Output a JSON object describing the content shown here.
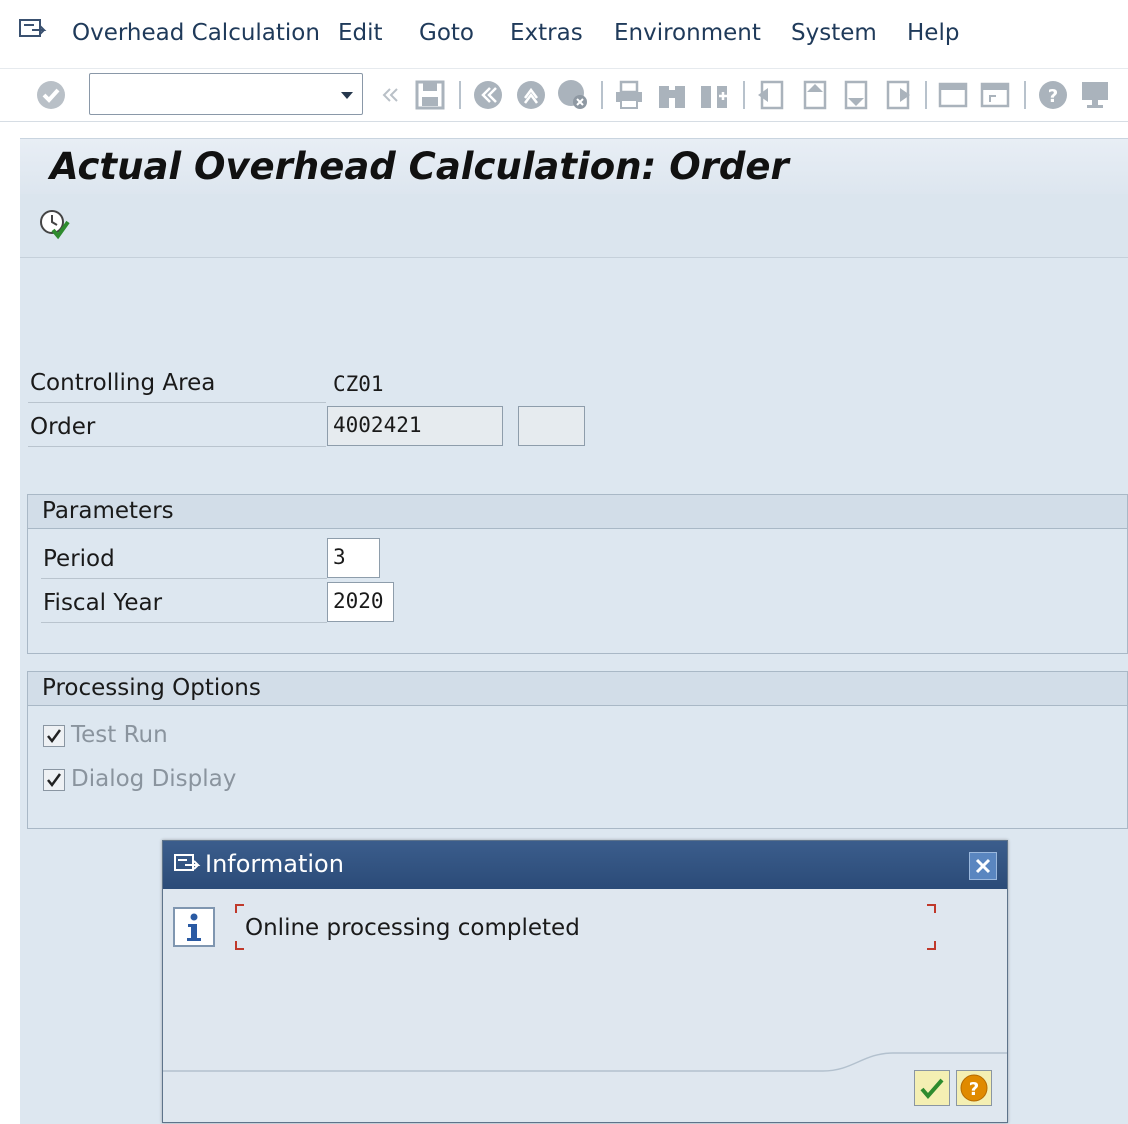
{
  "menu": {
    "items": [
      {
        "label": "Overhead Calculation"
      },
      {
        "label": "Edit"
      },
      {
        "label": "Goto"
      },
      {
        "label": "Extras"
      },
      {
        "label": "Environment"
      },
      {
        "label": "System"
      },
      {
        "label": "Help"
      }
    ]
  },
  "toolbar": {
    "command_field_value": "",
    "icons": [
      "check-icon",
      "save-icon",
      "back-icon",
      "exit-icon",
      "cancel-icon",
      "print-icon",
      "find-icon",
      "find-next-icon",
      "first-page-icon",
      "previous-page-icon",
      "next-page-icon",
      "last-page-icon",
      "create-session-icon",
      "shortcut-icon",
      "help-icon",
      "customize-layout-icon"
    ]
  },
  "page": {
    "title": "Actual Overhead Calculation: Order",
    "execute_icon": "execute-clock-icon"
  },
  "fields": {
    "controlling_area_label": "Controlling Area",
    "controlling_area_value": "CZ01",
    "order_label": "Order",
    "order_value": "4002421",
    "order_extra_value": ""
  },
  "parameters": {
    "title": "Parameters",
    "period_label": "Period",
    "period_value": "3",
    "fiscal_year_label": "Fiscal Year",
    "fiscal_year_value": "2020"
  },
  "processing": {
    "title": "Processing Options",
    "test_run_label": "Test Run",
    "test_run_checked": true,
    "dialog_display_label": "Dialog Display",
    "dialog_display_checked": true
  },
  "dialog": {
    "title": "Information",
    "message": "Online processing completed",
    "info_icon": "info-icon",
    "confirm_icon": "check-icon",
    "help_icon": "help-icon"
  },
  "colors": {
    "accent_title_bar": "#2b4b78",
    "background": "#dde7f0",
    "confirm_green": "#2e8b2e",
    "help_orange": "#e08a00"
  }
}
